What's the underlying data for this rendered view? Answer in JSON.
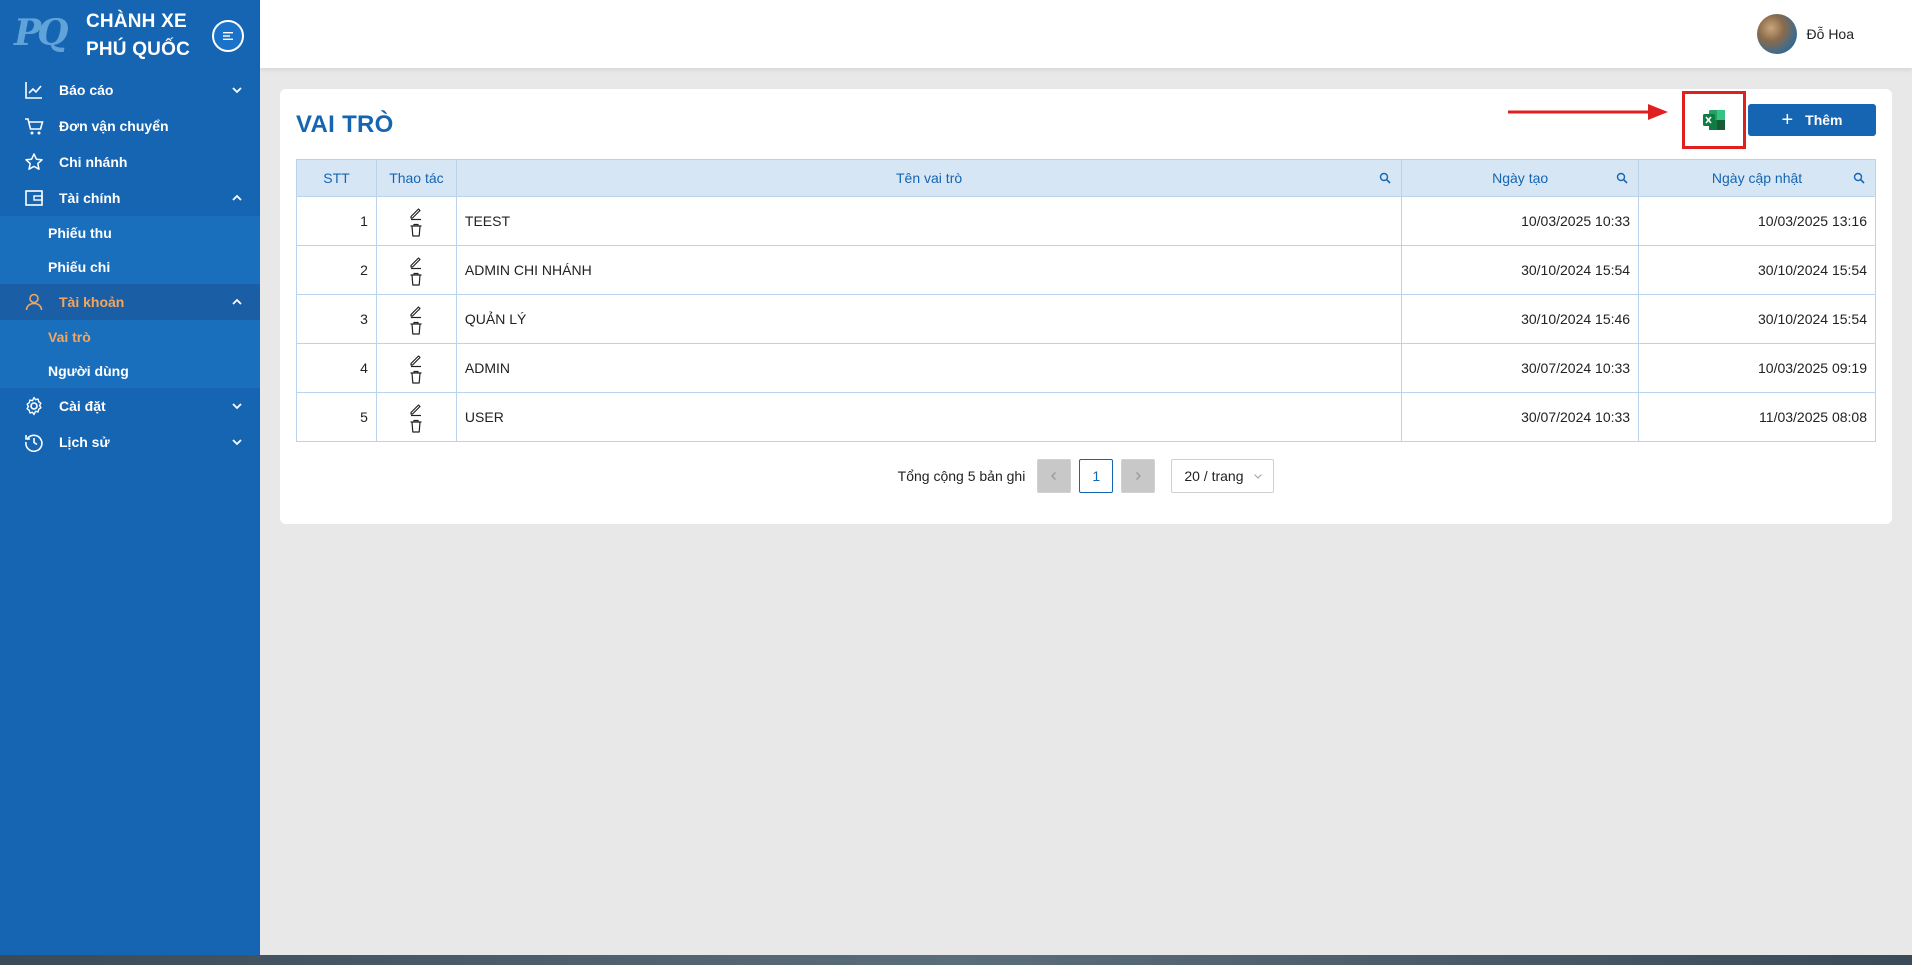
{
  "brand": {
    "logo": "PQ",
    "line1": "CHÀNH XE",
    "line2": "PHÚ QUỐC"
  },
  "sidebar": {
    "items": [
      {
        "label": "Báo cáo",
        "icon": "chart-line-icon"
      },
      {
        "label": "Đơn vận chuyển",
        "icon": "cart-icon"
      },
      {
        "label": "Chi nhánh",
        "icon": "star-icon"
      },
      {
        "label": "Tài chính",
        "icon": "wallet-icon",
        "children": [
          "Phiếu thu",
          "Phiếu chi"
        ]
      },
      {
        "label": "Tài khoản",
        "icon": "user-icon",
        "children": [
          "Vai trò",
          "Người dùng"
        ]
      },
      {
        "label": "Cài đặt",
        "icon": "gear-icon"
      },
      {
        "label": "Lịch sử",
        "icon": "history-icon"
      }
    ]
  },
  "header": {
    "user_name": "Đỗ Hoa"
  },
  "page": {
    "title": "VAI TRÒ",
    "add_label": "Thêm"
  },
  "table": {
    "headers": [
      "STT",
      "Thao tác",
      "Tên vai trò",
      "Ngày tạo",
      "Ngày cập nhật"
    ],
    "rows": [
      {
        "stt": "1",
        "name": "TEEST",
        "created": "10/03/2025 10:33",
        "updated": "10/03/2025 13:16"
      },
      {
        "stt": "2",
        "name": "ADMIN CHI NHÁNH",
        "created": "30/10/2024 15:54",
        "updated": "30/10/2024 15:54"
      },
      {
        "stt": "3",
        "name": "QUẢN LÝ",
        "created": "30/10/2024 15:46",
        "updated": "30/10/2024 15:54"
      },
      {
        "stt": "4",
        "name": "ADMIN",
        "created": "30/07/2024 10:33",
        "updated": "10/03/2025 09:19"
      },
      {
        "stt": "5",
        "name": "USER",
        "created": "30/07/2024 10:33",
        "updated": "11/03/2025 08:08"
      }
    ]
  },
  "pagination": {
    "total": "Tổng cộng 5 bản ghi",
    "current": "1",
    "page_size": "20 / trang"
  },
  "colors": {
    "primary": "#1565b3",
    "active": "#f5a65b",
    "highlight": "#e02020"
  }
}
